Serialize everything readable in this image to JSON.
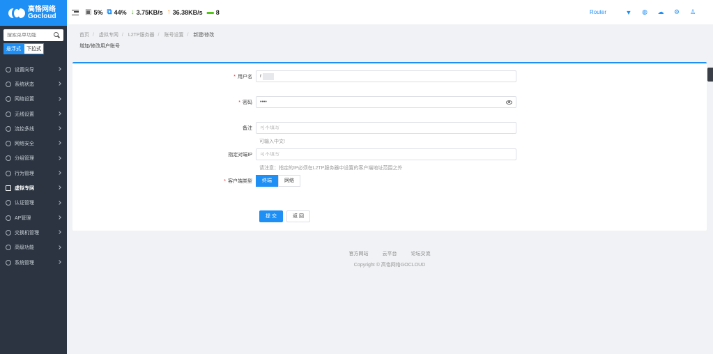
{
  "brand": {
    "name_cn": "高恪网络",
    "name_en": "Gocloud"
  },
  "sidebar": {
    "search_placeholder": "搜索菜单功能",
    "modes": [
      "悬浮式",
      "下拉式"
    ],
    "items": [
      {
        "label": "设置向导",
        "icon": "compass-icon"
      },
      {
        "label": "系统状态",
        "icon": "monitor-icon"
      },
      {
        "label": "网络设置",
        "icon": "network-icon"
      },
      {
        "label": "无线设置",
        "icon": "wifi-icon"
      },
      {
        "label": "流控多线",
        "icon": "flow-icon"
      },
      {
        "label": "网络安全",
        "icon": "shield-icon"
      },
      {
        "label": "分组管理",
        "icon": "group-icon"
      },
      {
        "label": "行为管理",
        "icon": "filter-icon"
      },
      {
        "label": "虚拟专网",
        "icon": "vpn-icon"
      },
      {
        "label": "认证管理",
        "icon": "auth-icon"
      },
      {
        "label": "AP管理",
        "icon": "ap-icon"
      },
      {
        "label": "交换机管理",
        "icon": "switch-icon"
      },
      {
        "label": "高级功能",
        "icon": "rocket-icon"
      },
      {
        "label": "系统管理",
        "icon": "gear-icon"
      }
    ],
    "active_index": 8
  },
  "header": {
    "cpu": "5%",
    "memory": "44%",
    "download": "3.75KB/s",
    "upload": "36.38KB/s",
    "devices": "8",
    "router_link": "Router",
    "colors": {
      "download": "#52c41a",
      "upload": "#fa8c16",
      "devices": "#52c41a",
      "accent": "#1e8ff5"
    }
  },
  "breadcrumb": {
    "items": [
      "首页",
      "虚拟专网",
      "L2TP服务器",
      "账号设置"
    ],
    "current": "新建/修改"
  },
  "page_title": "增加/修改用户账号",
  "form": {
    "username": {
      "label": "用户名",
      "value": "r"
    },
    "password": {
      "label": "密码",
      "value": "••••"
    },
    "remark": {
      "label": "备注",
      "placeholder": "可不填写",
      "hint": "可输入中文!"
    },
    "peer_ip": {
      "label": "指定对端IP",
      "placeholder": "可不填写",
      "hint": "请注意：指定的IP必须在L2TP服务器中设置的客户端地址范围之外"
    },
    "client_type": {
      "label": "客户端类型",
      "options": [
        "终端",
        "网络"
      ],
      "selected": "终端"
    },
    "submit_label": "提 交",
    "back_label": "返 回"
  },
  "footer": {
    "links": [
      "官方网站",
      "云平台",
      "论坛交流"
    ],
    "copyright": "Copyright © 高恪网络GOCLOUD"
  }
}
